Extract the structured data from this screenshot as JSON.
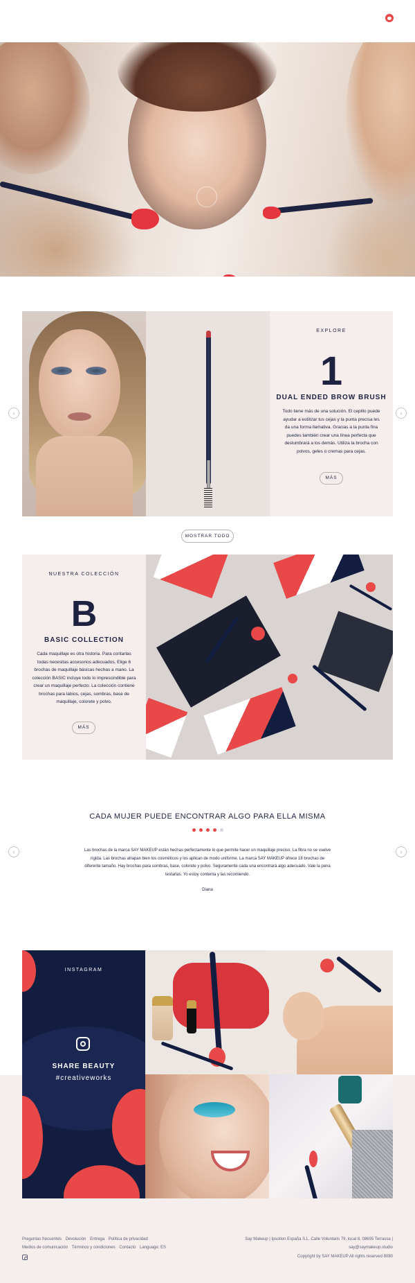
{
  "header": {
    "logo_icon": "say-makeup-logo-icon"
  },
  "hero": {
    "alt": "Makeup application scene"
  },
  "product": {
    "label": "EXPLORE",
    "number": "1",
    "title": "DUAL ENDED BROW BRUSH",
    "description": "Todo tiene más de una solución. El cepillo puede ayudar a estilizar tus cejas y la punta precisa les da una forma llamativa. Gracias a la punta fina puedes también crear una línea perfecta que deslumbrará a los demás. Utiliza la brocha con polvos, geles o cremas para cejas.",
    "button": "MÁS"
  },
  "show_all": "MOSTRAR TODO",
  "collection": {
    "label": "NUESTRA COLECCIÓN",
    "letter": "B",
    "title": "BASIC COLLECTION",
    "description": "Cada maquillaje es otra historia. Para contarlas todas necesitas accesorios adecuados. Elige 6 brochas de maquillaje básicas hechas a mano. La colección BASIC incluye todo lo imprescindible para crear un maquillaje perfecto. La colección contiene brochas para labios, cejas, sombras, base de maquillaje, colorete y polvo.",
    "button": "MÁS"
  },
  "testimonial": {
    "title": "CADA MUJER PUEDE ENCONTRAR ALGO PARA ELLA MISMA",
    "rating": 4,
    "rating_max": 5,
    "body": "Las brochas de la marca SAY MAKEUP están hechas perfectamente lo que permite hacer un maquillaje preciso. La fibra no se vuelve rígida. Las brochas atrapan bien los cosméticos y los aplican de modo uniforme. La marca SAY MAKEUP ofrece 18 brochas de diferente tamaño. Hay brochas para sombras, base, colorete y polvo. Seguramente cada una encontrará algo adecuado. Vale la pena testarlas. Yo estoy contenta y las recomiendo.",
    "author": "Diana"
  },
  "instagram": {
    "label": "INSTAGRAM",
    "headline": "SHARE BEAUTY",
    "hashtag": "#creativeworks"
  },
  "footer": {
    "links_row1": [
      "Preguntas frecuentes",
      "Devolución",
      "Entrega",
      "Política de privacidad"
    ],
    "links_row2": [
      "Medios de comunicación",
      "Términos y condiciones",
      "Contacto",
      "Language: ES"
    ],
    "company": "Say Makeup | Ipsotion España S.L. Calle Voluntaris 79, local 8, 08695 Terrassa |",
    "email": "say@saymakeup.studio",
    "copyright": "Copyright by SAY MAKEUP All rights reserved 8080"
  },
  "colors": {
    "navy": "#121d3f",
    "red": "#e94848",
    "blush": "#f6eeec"
  }
}
